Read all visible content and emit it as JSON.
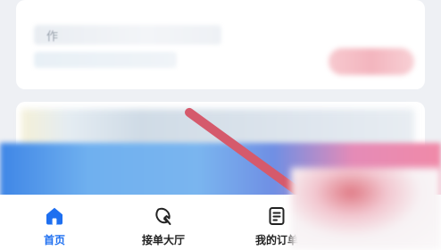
{
  "colors": {
    "accent": "#1e6ff0",
    "tab_text": "#222222",
    "annotation_stroke": "#d55a6c"
  },
  "top_card": {
    "blurred_char": "作"
  },
  "tabbar": {
    "tabs": [
      {
        "label": "首页",
        "icon": "home-icon",
        "active": true
      },
      {
        "label": "接单大厅",
        "icon": "hall-icon",
        "active": false
      },
      {
        "label": "我的订单",
        "icon": "orders-icon",
        "active": false
      }
    ]
  }
}
